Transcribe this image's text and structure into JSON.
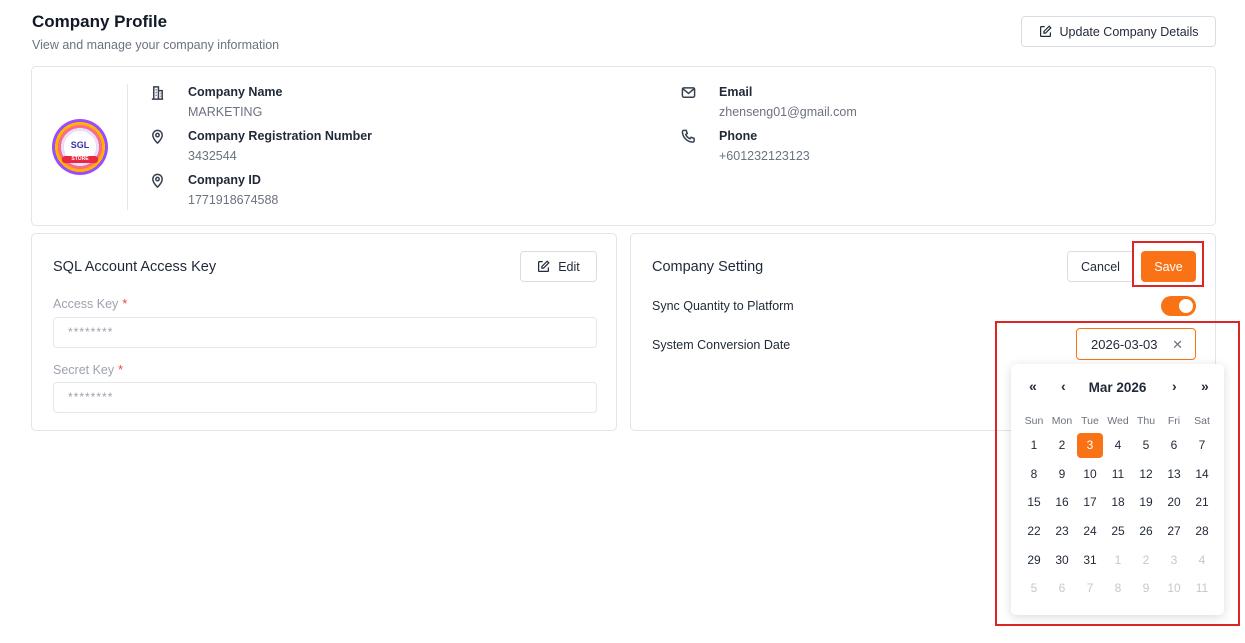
{
  "header": {
    "title": "Company Profile",
    "subtitle": "View and manage your company information",
    "update_button": "Update Company Details"
  },
  "profile": {
    "logo_text": "SGL",
    "logo_band_text": "STORE",
    "company_name_label": "Company Name",
    "company_name": "MARKETING",
    "reg_number_label": "Company Registration Number",
    "reg_number": "3432544",
    "company_id_label": "Company ID",
    "company_id": "1771918674588",
    "email_label": "Email",
    "email": "zhenseng01@gmail.com",
    "phone_label": "Phone",
    "phone": "+601232123123"
  },
  "access_key_card": {
    "title": "SQL Account Access Key",
    "edit_button": "Edit",
    "access_key_label": "Access Key",
    "access_key_value": "********",
    "secret_key_label": "Secret Key",
    "secret_key_value": "********",
    "required_mark": "*"
  },
  "setting_card": {
    "title": "Company Setting",
    "cancel_button": "Cancel",
    "save_button": "Save",
    "sync_label": "Sync Quantity to Platform",
    "sync_enabled": true,
    "conversion_label": "System Conversion Date",
    "conversion_value": "2026-03-03",
    "clear_symbol": "✕"
  },
  "calendar": {
    "prev_year": "«",
    "prev_month": "‹",
    "next_month": "›",
    "next_year": "»",
    "month_label": "Mar 2026",
    "weekdays": [
      "Sun",
      "Mon",
      "Tue",
      "Wed",
      "Thu",
      "Fri",
      "Sat"
    ],
    "weeks": [
      [
        {
          "d": "1"
        },
        {
          "d": "2"
        },
        {
          "d": "3",
          "sel": true
        },
        {
          "d": "4"
        },
        {
          "d": "5"
        },
        {
          "d": "6"
        },
        {
          "d": "7"
        }
      ],
      [
        {
          "d": "8"
        },
        {
          "d": "9"
        },
        {
          "d": "10"
        },
        {
          "d": "11"
        },
        {
          "d": "12"
        },
        {
          "d": "13"
        },
        {
          "d": "14"
        }
      ],
      [
        {
          "d": "15"
        },
        {
          "d": "16"
        },
        {
          "d": "17"
        },
        {
          "d": "18"
        },
        {
          "d": "19"
        },
        {
          "d": "20"
        },
        {
          "d": "21"
        }
      ],
      [
        {
          "d": "22"
        },
        {
          "d": "23"
        },
        {
          "d": "24"
        },
        {
          "d": "25"
        },
        {
          "d": "26"
        },
        {
          "d": "27"
        },
        {
          "d": "28"
        }
      ],
      [
        {
          "d": "29"
        },
        {
          "d": "30"
        },
        {
          "d": "31"
        },
        {
          "d": "1",
          "muted": true
        },
        {
          "d": "2",
          "muted": true
        },
        {
          "d": "3",
          "muted": true
        },
        {
          "d": "4",
          "muted": true
        }
      ],
      [
        {
          "d": "5",
          "muted": true
        },
        {
          "d": "6",
          "muted": true
        },
        {
          "d": "7",
          "muted": true
        },
        {
          "d": "8",
          "muted": true
        },
        {
          "d": "9",
          "muted": true
        },
        {
          "d": "10",
          "muted": true
        },
        {
          "d": "11",
          "muted": true
        }
      ]
    ]
  },
  "colors": {
    "accent": "#f97316",
    "highlight": "#dc2626"
  }
}
